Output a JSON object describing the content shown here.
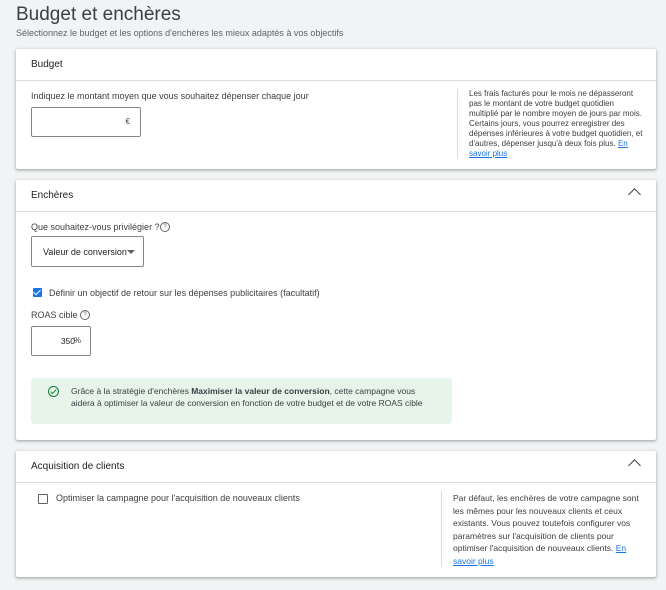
{
  "page": {
    "title": "Budget et enchères",
    "subtitle": "Sélectionnez le budget et les options d'enchères les mieux adaptés à vos objectifs"
  },
  "budget": {
    "header": "Budget",
    "prompt": "Indiquez le montant moyen que vous souhaitez dépenser chaque jour",
    "input_value": "",
    "currency": "€",
    "note": "Les frais facturés pour le mois ne dépasseront pas le montant de votre budget quotidien multiplié par le nombre moyen de jours par mois. Certains jours, vous pourrez enregistrer des dépenses inférieures à votre budget quotidien, et d'autres, dépenser jusqu'à deux fois plus.",
    "learn_more": "En savoir plus"
  },
  "bidding": {
    "header": "Enchères",
    "focus_question": "Que souhaitez-vous privilégier ?",
    "focus_value": "Valeur de conversion",
    "roas_checkbox_label": "Définir un objectif de retour sur les dépenses publicitaires (facultatif)",
    "roas_checked": true,
    "roas_label": "ROAS cible",
    "roas_value": "350",
    "roas_unit": "%",
    "info_prefix": "Grâce à la stratégie d'enchères ",
    "info_bold": "Maximiser la valeur de conversion",
    "info_suffix": ", cette campagne vous aidera à optimiser la valeur de conversion en fonction de votre budget et de votre ROAS cible"
  },
  "acquisition": {
    "header": "Acquisition de clients",
    "checkbox_label": "Optimiser la campagne pour l'acquisition de nouveaux clients",
    "checked": false,
    "note": "Par défaut, les enchères de votre campagne sont les mêmes pour les nouveaux clients et ceux existants. Vous pouvez toutefois configurer vos paramètres sur l'acquisition de clients pour optimiser l'acquisition de nouveaux clients.",
    "learn_more": "En savoir plus"
  },
  "colors": {
    "accent": "#1a73e8",
    "success": "#188038",
    "info_bg": "#e6f4ea"
  }
}
